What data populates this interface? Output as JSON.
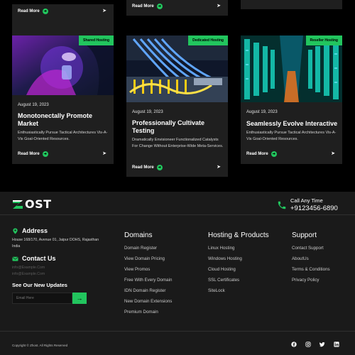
{
  "top_cards": [
    {
      "read_more": "Read More"
    },
    {
      "read_more": "Read More"
    }
  ],
  "cards": [
    {
      "tag": "Shared Hosting",
      "date": "August 19, 2023",
      "title": "Monotonectally Promote Market",
      "description": "Enthusiastically Pursue Tactical Architectures Vis-A-Vis Goal-Oriented Resources.",
      "read_more": "Read More"
    },
    {
      "tag": "Dedicated Hosting",
      "date": "August 19, 2023",
      "title": "Professionally Cultivate Testing",
      "description": "Dramatically Envisioneer Functionalized Catalysts For Change Without Enterprise-Wide Meta-Services.",
      "read_more": "Read More"
    },
    {
      "tag": "Reseller Hosting",
      "date": "August 19, 2023",
      "title": "Seamlessly Evolve Interactive",
      "description": "Enthusiastically Pursue Tactical Architectures Vis-A-Vis Goal-Oriented Resources.",
      "read_more": "Read More"
    }
  ],
  "footer": {
    "logo_text": "OST",
    "call_label": "Call Any Time",
    "call_number": "+9123456-6890",
    "address_heading": "Address",
    "address_line1": "House 168/170, Avenue 01, Jaipur DOHS, Rajasthan",
    "address_line2": "India",
    "contact_heading": "Contact Us",
    "email1": "info@Example.Com",
    "email2": "info@Example.Com",
    "newsletter_heading": "See Our New Updates",
    "newsletter_placeholder": "Email Here",
    "domains_heading": "Domains",
    "domains": [
      "Domain Register",
      "View Domain Pricing",
      "View Promos",
      "Free With Every Domain",
      "IDN Domain Register",
      "New Domain Extensions",
      "Premium Domain"
    ],
    "hosting_heading": "Hosting & Products",
    "hosting": [
      "Linux Hosting",
      "Windows Hosting",
      "Cloud Hosting",
      "SSL Certificates",
      "SiteLock"
    ],
    "support_heading": "Support",
    "support": [
      "Contact Support",
      "AboutUs",
      "Terms & Conditions",
      "Privacy Policy"
    ],
    "copyright": "Copyright © Zhost. All Rights Reserved",
    "socials": [
      "facebook-icon",
      "instagram-icon",
      "twitter-icon",
      "linkedin-icon"
    ]
  },
  "colors": {
    "accent": "#22c55e",
    "background": "#000000",
    "card": "#1f1f1f",
    "footer": "#1a1a1a"
  }
}
